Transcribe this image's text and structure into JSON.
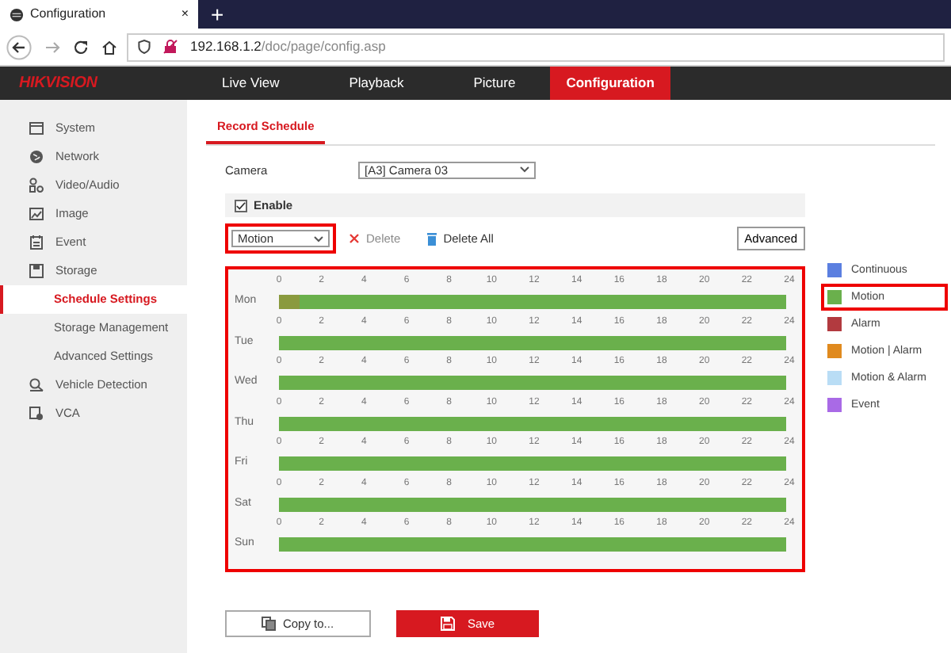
{
  "browser": {
    "tab_title": "Configuration",
    "close": "×",
    "new_tab": "+",
    "url_host": "192.168.1.2",
    "url_path": "/doc/page/config.asp"
  },
  "app": {
    "logo": "HIKVISION",
    "nav": [
      {
        "label": "Live View",
        "selected": false
      },
      {
        "label": "Playback",
        "selected": false
      },
      {
        "label": "Picture",
        "selected": false
      },
      {
        "label": "Configuration",
        "selected": true
      }
    ]
  },
  "sidebar": {
    "items": [
      {
        "label": "System",
        "selected": false
      },
      {
        "label": "Network",
        "selected": false
      },
      {
        "label": "Video/Audio",
        "selected": false
      },
      {
        "label": "Image",
        "selected": false
      },
      {
        "label": "Event",
        "selected": false
      },
      {
        "label": "Storage",
        "selected": false,
        "children": [
          {
            "label": "Schedule Settings",
            "selected": true
          },
          {
            "label": "Storage Management",
            "selected": false
          },
          {
            "label": "Advanced Settings",
            "selected": false
          }
        ]
      },
      {
        "label": "Vehicle Detection",
        "selected": false
      },
      {
        "label": "VCA",
        "selected": false
      }
    ]
  },
  "page_tabs": [
    {
      "label": "Record Schedule",
      "selected": true
    }
  ],
  "camera": {
    "label": "Camera",
    "value": "[A3] Camera 03"
  },
  "enable": {
    "label": "Enable",
    "checked": true
  },
  "type_select": {
    "value": "Motion",
    "highlighted": true
  },
  "delete": {
    "label": "Delete",
    "disabled": true
  },
  "delete_all": {
    "label": "Delete All",
    "disabled": false
  },
  "advanced": {
    "label": "Advanced"
  },
  "schedule": {
    "highlighted": true,
    "days": [
      {
        "label": "Mon",
        "hour_labels": [
          "0",
          "2",
          "4",
          "6",
          "8",
          "10",
          "12",
          "14",
          "16",
          "18",
          "20",
          "22",
          "24"
        ],
        "segments": [
          {
            "level": 0.04,
            "selected": true
          },
          {
            "level": 0.96,
            "selected": false
          }
        ]
      },
      {
        "label": "Tue",
        "hour_labels": [
          "0",
          "2",
          "4",
          "6",
          "8",
          "10",
          "12",
          "14",
          "16",
          "18",
          "20",
          "22",
          "24"
        ],
        "segments": [
          {
            "level": 1,
            "selected": false
          }
        ]
      },
      {
        "label": "Wed",
        "hour_labels": [
          "0",
          "2",
          "4",
          "6",
          "8",
          "10",
          "12",
          "14",
          "16",
          "18",
          "20",
          "22",
          "24"
        ],
        "segments": [
          {
            "level": 1,
            "selected": false
          }
        ]
      },
      {
        "label": "Thu",
        "hour_labels": [
          "0",
          "2",
          "4",
          "6",
          "8",
          "10",
          "12",
          "14",
          "16",
          "18",
          "20",
          "22",
          "24"
        ],
        "segments": [
          {
            "level": 1,
            "selected": false
          }
        ]
      },
      {
        "label": "Fri",
        "hour_labels": [
          "0",
          "2",
          "4",
          "6",
          "8",
          "10",
          "12",
          "14",
          "16",
          "18",
          "20",
          "22",
          "24"
        ],
        "segments": [
          {
            "level": 1,
            "selected": false
          }
        ]
      },
      {
        "label": "Sat",
        "hour_labels": [
          "0",
          "2",
          "4",
          "6",
          "8",
          "10",
          "12",
          "14",
          "16",
          "18",
          "20",
          "22",
          "24"
        ],
        "segments": [
          {
            "level": 1,
            "selected": false
          }
        ]
      },
      {
        "label": "Sun",
        "hour_labels": [
          "0",
          "2",
          "4",
          "6",
          "8",
          "10",
          "12",
          "14",
          "16",
          "18",
          "20",
          "22",
          "24"
        ],
        "segments": [
          {
            "level": 1,
            "selected": false
          }
        ]
      }
    ]
  },
  "legend": [
    {
      "label": "Continuous",
      "color": "#5b7fe0",
      "highlighted": false
    },
    {
      "label": "Motion",
      "color": "#6ab04c",
      "highlighted": true
    },
    {
      "label": "Alarm",
      "color": "#b23a3f",
      "highlighted": false
    },
    {
      "label": "Motion | Alarm",
      "color": "#e08a1e",
      "highlighted": false
    },
    {
      "label": "Motion & Alarm",
      "color": "#b9ddf5",
      "highlighted": false
    },
    {
      "label": "Event",
      "color": "#a96ae6",
      "highlighted": false
    }
  ],
  "buttons": {
    "copy": "Copy to...",
    "save": "Save"
  }
}
